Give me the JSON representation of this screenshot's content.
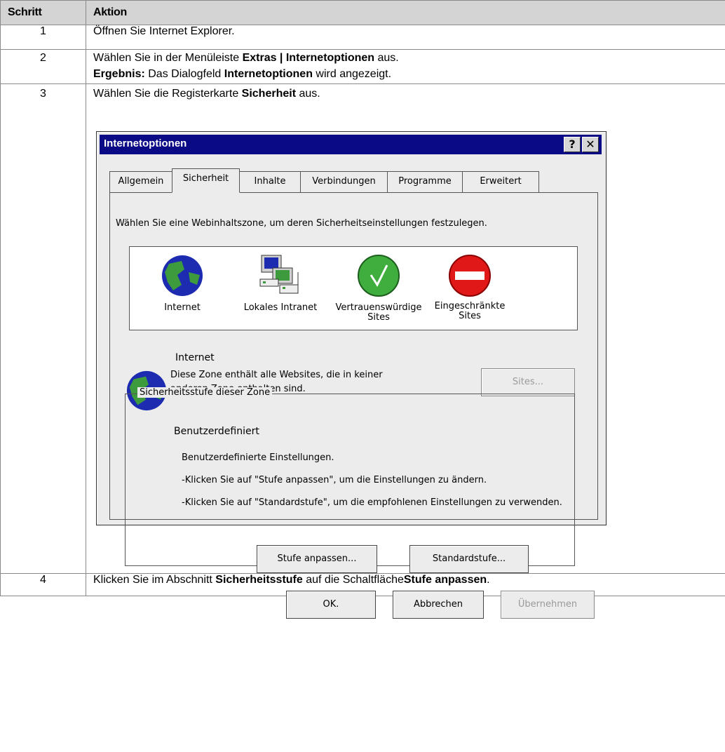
{
  "table": {
    "headers": [
      "Schritt",
      "Aktion"
    ],
    "rows": [
      {
        "num": "1",
        "text": "Öffnen Sie Internet Explorer."
      },
      {
        "num": "2",
        "line1_a": "Wählen Sie in der Menüleiste ",
        "line1_b": "Extras | Internetoptionen",
        "line1_c": " aus.",
        "line2_a": "Ergebnis:",
        "line2_b": " Das Dialogfeld ",
        "line2_c": "Internetoptionen",
        "line2_d": " wird angezeigt."
      },
      {
        "num": "3",
        "text_a": "Wählen Sie die Registerkarte ",
        "text_b": "Sicherheit",
        "text_c": " aus."
      },
      {
        "num": "4",
        "text_a": "Klicken Sie im Abschnitt ",
        "text_b": "Sicherheitsstufe",
        "text_c": " auf die Schaltfläche",
        "text_d": "Stufe anpassen",
        "text_e": "."
      }
    ]
  },
  "dialog": {
    "title": "Internetoptionen",
    "help_glyph": "?",
    "close_glyph": "✕",
    "tabs": [
      "Allgemein",
      "Sicherheit",
      "Inhalte",
      "Verbindungen",
      "Programme",
      "Erweitert"
    ],
    "active_tab": "Sicherheit",
    "intro": "Wählen Sie eine Webinhaltszone, um deren Sicherheitseinstellungen festzulegen.",
    "zones": [
      {
        "label": "Internet",
        "icon": "globe-icon"
      },
      {
        "label": "Lokales Intranet",
        "icon": "intranet-computers-icon"
      },
      {
        "label": "Vertrauenswürdige Sites",
        "label_l1": "Vertrauenswürdige",
        "label_l2": "Sites",
        "icon": "check-circle-icon"
      },
      {
        "label": "Eingeschränkte Sites",
        "label_l1": "Eingeschränkte",
        "label_l2": "Sites",
        "icon": "no-entry-icon"
      }
    ],
    "selected_zone": {
      "title": "Internet",
      "desc_l1": "Diese Zone enthält alle Websites, die in keiner",
      "desc_l2": "anderen Zone enthalten sind."
    },
    "sites_button": "Sites...",
    "level_group": {
      "legend": "Sicherheitsstufe dieser Zone",
      "title": "Benutzerdefiniert",
      "lines": [
        "Benutzerdefinierte Einstellungen.",
        "-Klicken Sie auf \"Stufe anpassen\", um die Einstellungen zu ändern.",
        "-Klicken Sie auf \"Standardstufe\", um die empfohlenen Einstellungen zu verwenden."
      ],
      "customize_button": "Stufe anpassen...",
      "default_button": "Standardstufe..."
    },
    "buttons": {
      "ok": "OK.",
      "cancel": "Abbrechen",
      "apply": "Übernehmen"
    },
    "colors": {
      "titlebar": "#0a0a86",
      "globe_blue": "#1c2bb0",
      "globe_green": "#3d9a3d",
      "trusted_green": "#3fae3f",
      "restricted_red": "#e01818"
    }
  }
}
